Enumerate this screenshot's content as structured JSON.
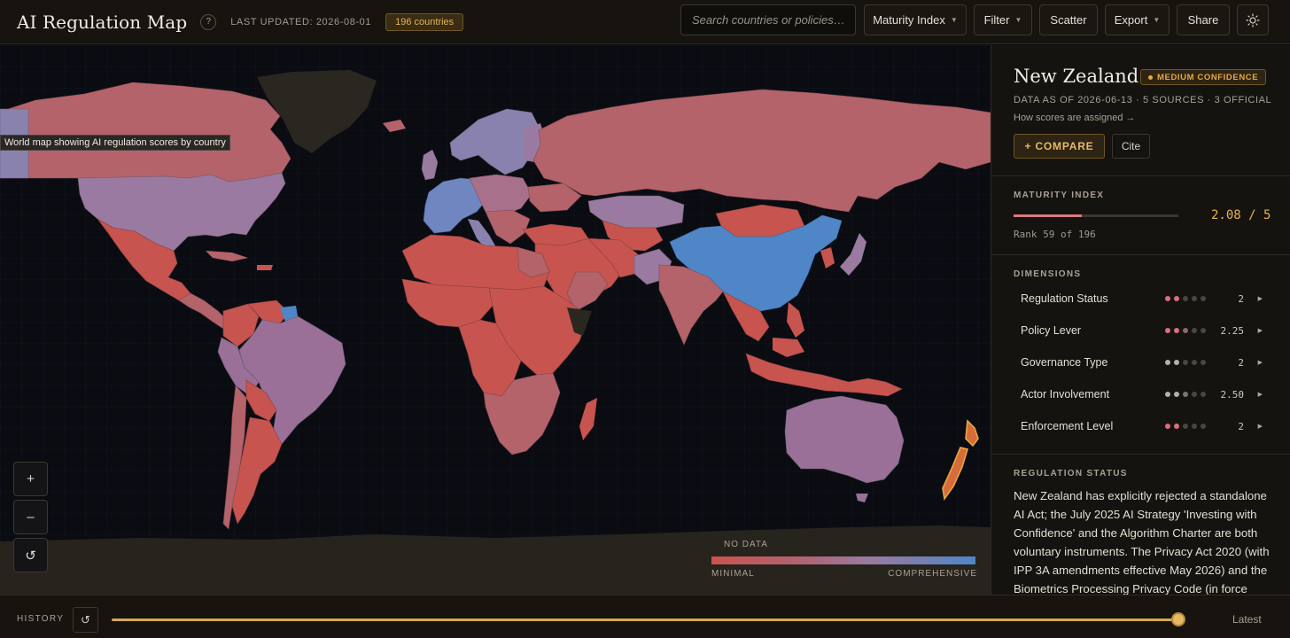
{
  "header": {
    "title": "AI Regulation Map",
    "help_icon": "?",
    "last_updated": "LAST UPDATED: 2026-08-01",
    "count_badge": "196 countries",
    "search_placeholder": "Search countries or policies…",
    "index_select": "Maturity Index",
    "filter_label": "Filter",
    "scatter_label": "Scatter",
    "export_label": "Export",
    "share_label": "Share",
    "theme_icon": "sun-icon"
  },
  "map": {
    "tooltip": "World map showing AI regulation scores by country",
    "zoom_in": "+",
    "zoom_out": "–",
    "reset": "↺",
    "legend": {
      "no_data": "NO DATA",
      "min_label": "MINIMAL",
      "max_label": "COMPREHENSIVE",
      "colors": [
        "#c9544e",
        "#b06474",
        "#9a7aa0",
        "#4e86c8"
      ]
    },
    "colors": {
      "ocean": "#0a0c12",
      "no_data": "#2a2620",
      "minimal": "#c9514c",
      "low": "#b56067",
      "mid": "#9a7098",
      "high": "#8a82ae",
      "comprehensive": "#4e86c8",
      "selected": "#d86b3c"
    }
  },
  "panel": {
    "country": "New Zealand",
    "confidence": "MEDIUM CONFIDENCE",
    "meta": "DATA AS OF 2026-06-13 · 5 SOURCES · 3 OFFICIAL",
    "scores_link": "How scores are assigned →",
    "compare_label": "+ COMPARE",
    "cite_label": "Cite",
    "maturity_heading": "MATURITY INDEX",
    "maturity_value": "2.08 / 5",
    "maturity_score": 2.08,
    "maturity_max": 5,
    "rank": "Rank 59 of 196",
    "dimensions_heading": "DIMENSIONS",
    "dimensions": [
      {
        "label": "Regulation Status",
        "value": "2",
        "score": 2,
        "dot_colors": [
          "#d8707a",
          "#d8707a",
          "#4a4640",
          "#4a4640",
          "#4a4640"
        ]
      },
      {
        "label": "Policy Lever",
        "value": "2.25",
        "score": 2.25,
        "dot_colors": [
          "#d8707a",
          "#d8707a",
          "#8a6a6c",
          "#4a4640",
          "#4a4640"
        ]
      },
      {
        "label": "Governance Type",
        "value": "2",
        "score": 2,
        "dot_colors": [
          "#b8b0a4",
          "#b8b0a4",
          "#4a4640",
          "#4a4640",
          "#4a4640"
        ]
      },
      {
        "label": "Actor Involvement",
        "value": "2.50",
        "score": 2.5,
        "dot_colors": [
          "#b8b0a4",
          "#b8b0a4",
          "#7d7770",
          "#4a4640",
          "#4a4640"
        ]
      },
      {
        "label": "Enforcement Level",
        "value": "2",
        "score": 2,
        "dot_colors": [
          "#d8707a",
          "#d8707a",
          "#4a4640",
          "#4a4640",
          "#4a4640"
        ]
      }
    ],
    "status_heading": "REGULATION STATUS",
    "status_text": "New Zealand has explicitly rejected a standalone AI Act; the July 2025 AI Strategy 'Investing with Confidence' and the Algorithm Charter are both voluntary instruments. The Privacy Act 2020 (with IPP 3A amendments effective May 2026) and the Biometrics Processing Privacy Code (in force"
  },
  "history": {
    "label": "HISTORY",
    "reset_icon": "↺",
    "latest_label": "Latest",
    "position": 1.0
  }
}
